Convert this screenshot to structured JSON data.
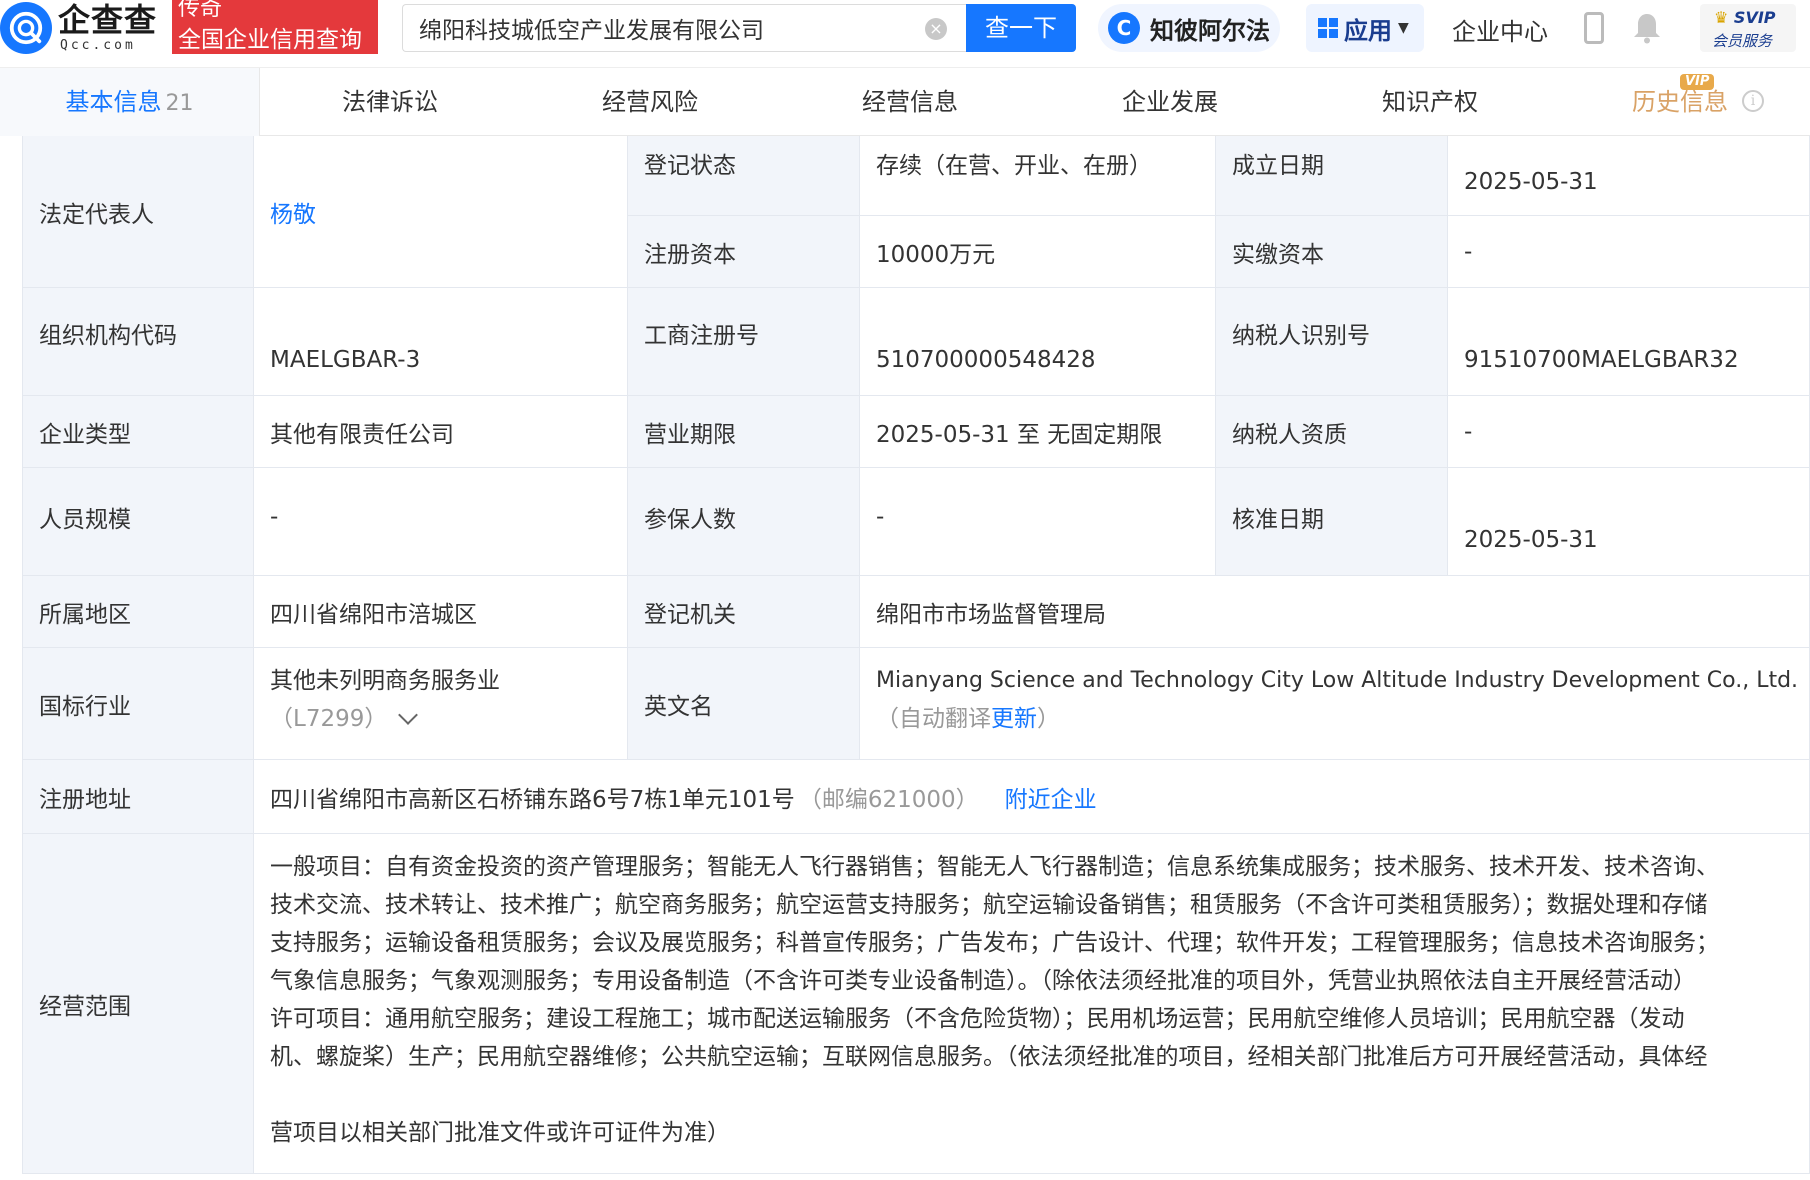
{
  "header": {
    "logo_main": "企查查",
    "logo_sub": "Qcc.com",
    "badge_line1": "传奇",
    "badge_line2": "全国企业信用查询",
    "search_value": "绵阳科技城低空产业发展有限公司",
    "search_button": "查一下",
    "zhibi_label": "知彼阿尔法",
    "apps_label": "应用",
    "enterprise_center": "企业中心",
    "svip_title": "SVIP",
    "svip_sub": "会员服务"
  },
  "tabs": [
    {
      "label": "基本信息",
      "count": "21"
    },
    {
      "label": "法律诉讼"
    },
    {
      "label": "经营风险"
    },
    {
      "label": "经营信息"
    },
    {
      "label": "企业发展"
    },
    {
      "label": "知识产权"
    },
    {
      "label": "历史信息",
      "tag": "VIP"
    }
  ],
  "info": {
    "legal_rep_label": "法定代表人",
    "legal_rep_value": "杨敬",
    "reg_status_label": "登记状态",
    "reg_status_value": "存续（在营、开业、在册）",
    "found_date_label": "成立日期",
    "found_date_value": "2025-05-31",
    "reg_capital_label": "注册资本",
    "reg_capital_value": "10000万元",
    "paid_capital_label": "实缴资本",
    "paid_capital_value": "-",
    "org_code_label": "组织机构代码",
    "org_code_value": "MAELGBAR-3",
    "biz_reg_no_label": "工商注册号",
    "biz_reg_no_value": "510700000548428",
    "taxpayer_id_label": "纳税人识别号",
    "taxpayer_id_value": "91510700MAELGBAR32",
    "company_type_label": "企业类型",
    "company_type_value": "其他有限责任公司",
    "biz_term_label": "营业期限",
    "biz_term_value": "2025-05-31 至 无固定期限",
    "taxpayer_qual_label": "纳税人资质",
    "taxpayer_qual_value": "-",
    "staff_size_label": "人员规模",
    "staff_size_value": "-",
    "insured_label": "参保人数",
    "insured_value": "-",
    "approval_date_label": "核准日期",
    "approval_date_value": "2025-05-31",
    "region_label": "所属地区",
    "region_value": "四川省绵阳市涪城区",
    "reg_authority_label": "登记机关",
    "reg_authority_value": "绵阳市市场监督管理局",
    "industry_label": "国标行业",
    "industry_value": "其他未列明商务服务业",
    "industry_code": "（L7299）",
    "english_name_label": "英文名",
    "english_name_value": "Mianyang Science and Technology City Low Altitude Industry Development Co., Ltd.",
    "translate_note_prefix": "（自动翻译",
    "translate_update": "更新",
    "translate_note_suffix": "）",
    "address_label": "注册地址",
    "address_value": "四川省绵阳市高新区石桥铺东路6号7栋1单元101号",
    "postcode": "（邮编621000）",
    "nearby_link": "附近企业",
    "scope_label": "经营范围",
    "scope_lines": [
      "一般项目：自有资金投资的资产管理服务；智能无人飞行器销售；智能无人飞行器制造；信息系统集成服务；技术服务、技术开发、技术咨询、",
      "技术交流、技术转让、技术推广；航空商务服务；航空运营支持服务；航空运输设备销售；租赁服务（不含许可类租赁服务）；数据处理和存储",
      "支持服务；运输设备租赁服务；会议及展览服务；科普宣传服务；广告发布；广告设计、代理；软件开发；工程管理服务；信息技术咨询服务；",
      "气象信息服务；气象观测服务；专用设备制造（不含许可类专业设备制造）。（除依法须经批准的项目外，凭营业执照依法自主开展经营活动）",
      "许可项目：通用航空服务；建设工程施工；城市配送运输服务（不含危险货物）；民用机场运营；民用航空维修人员培训；民用航空器（发动",
      "机、螺旋桨）生产；民用航空器维修；公共航空运输；互联网信息服务。（依法须经批准的项目，经相关部门批准后方可开展经营活动，具体经",
      "营项目以相关部门批准文件或许可证件为准）"
    ]
  },
  "colors": {
    "brand_blue": "#1677ff",
    "badge_red": "#e4393c",
    "label_bg": "#f2f5fa",
    "history_gold": "#d9a266"
  }
}
